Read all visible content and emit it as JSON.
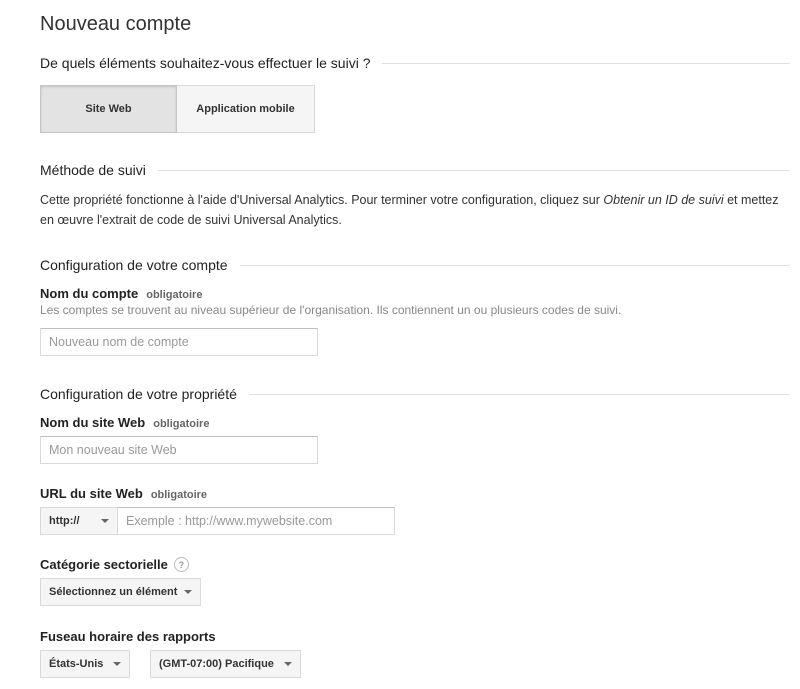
{
  "page": {
    "title": "Nouveau compte"
  },
  "tracking": {
    "question": "De quels éléments souhaitez-vous effectuer le suivi ?",
    "options": [
      {
        "label": "Site Web",
        "selected": true
      },
      {
        "label": "Application mobile",
        "selected": false
      }
    ]
  },
  "method": {
    "header": "Méthode de suivi",
    "text_before": "Cette propriété fonctionne à l'aide d'Universal Analytics. Pour terminer votre configuration, cliquez sur ",
    "text_italic": "Obtenir un ID de suivi",
    "text_after": " et mettez en œuvre l'extrait de code de suivi Universal Analytics."
  },
  "account": {
    "header": "Configuration de votre compte",
    "name_label": "Nom du compte",
    "required": "obligatoire",
    "help": "Les comptes se trouvent au niveau supérieur de l'organisation. Ils contiennent un ou plusieurs codes de suivi.",
    "name_placeholder": "Nouveau nom de compte"
  },
  "property": {
    "header": "Configuration de votre propriété",
    "site_name_label": "Nom du site Web",
    "site_name_placeholder": "Mon nouveau site Web",
    "url_label": "URL du site Web",
    "protocol": "http://",
    "url_placeholder": "Exemple : http://www.mywebsite.com",
    "category_label": "Catégorie sectorielle",
    "help_icon": "?",
    "category_value": "Sélectionnez un élément",
    "timezone_label": "Fuseau horaire des rapports",
    "country_value": "États-Unis",
    "timezone_value": "(GMT-07:00) Pacifique",
    "required": "obligatoire"
  },
  "icons": {
    "caret": "chevron-down-icon",
    "help": "help-circle-icon"
  },
  "colors": {
    "text": "#222222",
    "muted": "#888888",
    "border": "#d9d9d9",
    "button_bg": "#f5f5f5",
    "selected_bg": "#e3e3e3"
  }
}
